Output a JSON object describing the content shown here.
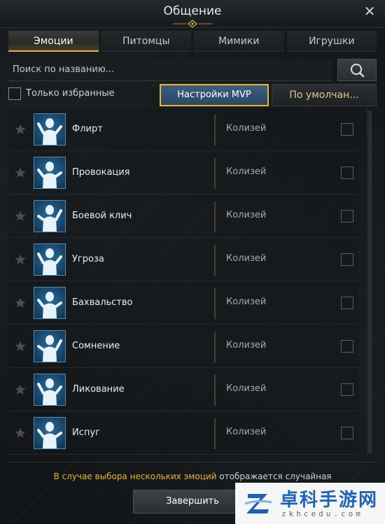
{
  "window": {
    "title": "Общение",
    "close_icon": "close-icon"
  },
  "tabs": [
    {
      "label": "Эмоции",
      "active": true
    },
    {
      "label": "Питомцы",
      "active": false
    },
    {
      "label": "Мимики",
      "active": false
    },
    {
      "label": "Игрушки",
      "active": false
    }
  ],
  "search": {
    "placeholder": "Поиск по названию...",
    "value": ""
  },
  "filter": {
    "favorites_label": "Только избранные",
    "favorites_checked": false,
    "mvp_label": "Настройки MVP",
    "default_label": "По умолчан..."
  },
  "emotes": [
    {
      "name": "Флирт",
      "source": "Колизей",
      "checked": false
    },
    {
      "name": "Провокация",
      "source": "Колизей",
      "checked": false
    },
    {
      "name": "Боевой клич",
      "source": "Колизей",
      "checked": false
    },
    {
      "name": "Угроза",
      "source": "Колизей",
      "checked": false
    },
    {
      "name": "Бахвальство",
      "source": "Колизей",
      "checked": false
    },
    {
      "name": "Сомнение",
      "source": "Колизей",
      "checked": false
    },
    {
      "name": "Ликование",
      "source": "Колизей",
      "checked": false
    },
    {
      "name": "Испуг",
      "source": "Колизей",
      "checked": false
    }
  ],
  "notice": {
    "highlight": "В случае выбора нескольких эмоций",
    "rest": " отображается случайная"
  },
  "finish_label": "Завершить",
  "watermark": {
    "text_cn": "卓科手游网",
    "url": "zkhcedu.com"
  },
  "colors": {
    "accent_gold": "#e8b82a",
    "mvp_blue": "#3c5f80",
    "icon_blue": "#2c6c9a"
  }
}
